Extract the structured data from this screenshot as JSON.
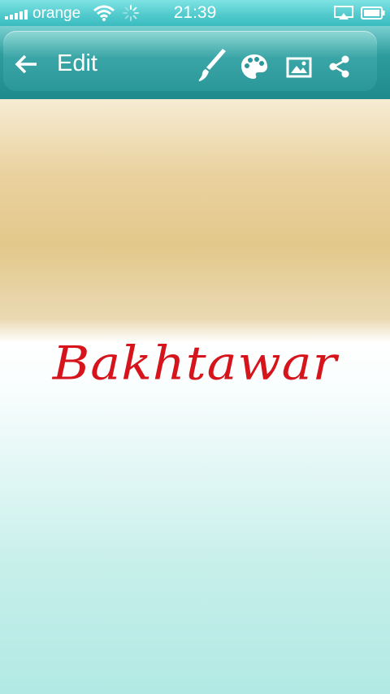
{
  "status_bar": {
    "carrier": "orange",
    "time": "21:39"
  },
  "toolbar": {
    "title": "Edit",
    "icons": [
      "back-arrow-icon",
      "brush-icon",
      "palette-icon",
      "image-icon",
      "share-icon"
    ]
  },
  "canvas": {
    "text": "Bakhtawar",
    "text_color": "#d6141c"
  },
  "colors": {
    "accent": "#2a9799",
    "status_bar": "#4fc9cc"
  }
}
